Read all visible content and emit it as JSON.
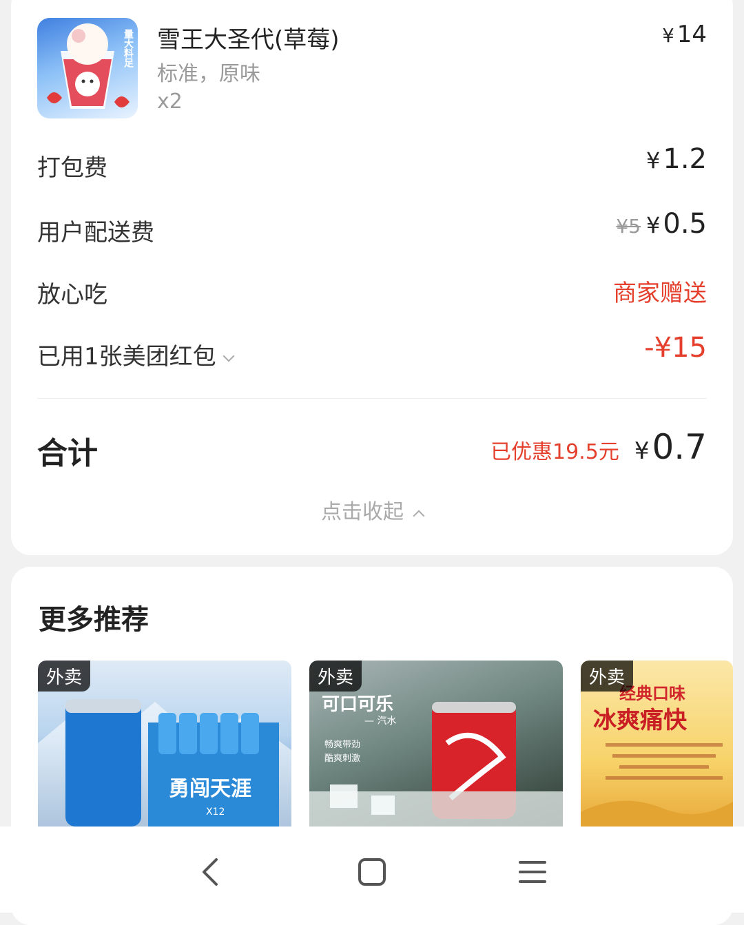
{
  "order": {
    "item": {
      "name": "雪王大圣代(草莓)",
      "spec": "标准，原味",
      "qty": "x2",
      "price": "14",
      "thumb_badge": "量大料足"
    },
    "fees": [
      {
        "label": "打包费",
        "value": "1.2"
      },
      {
        "label": "用户配送费",
        "original": "¥5",
        "value": "0.5"
      },
      {
        "label": "放心吃",
        "value": "商家赠送"
      },
      {
        "label": "已用1张美团红包",
        "value": "-¥15"
      }
    ],
    "total": {
      "label": "合计",
      "discount": "已优惠19.5元",
      "amount": "0.7"
    },
    "collapse_label": "点击收起",
    "currency": "¥"
  },
  "recommendations": {
    "title": "更多推荐",
    "items": [
      {
        "tag": "外卖",
        "text_1": "勇闯天涯",
        "text_2": "X12"
      },
      {
        "tag": "外卖",
        "text_1": "可口可乐",
        "text_2": "— 汽水",
        "text_3": "畅爽带劲",
        "text_4": "酷爽刺激"
      },
      {
        "tag": "外卖",
        "text_1": "经典口味",
        "text_2": "冰爽痛快"
      }
    ]
  },
  "colors": {
    "accent_red": "#e5402d",
    "muted": "#9a9a9a",
    "background": "#f1f1f1"
  },
  "navbar": {
    "icons": [
      "back-icon",
      "home-icon",
      "menu-icon"
    ]
  }
}
